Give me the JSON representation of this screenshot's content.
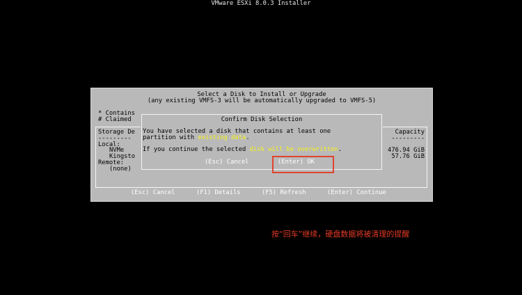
{
  "installer_title": "VMware ESXi 8.0.3 Installer",
  "select_disk": {
    "line1": "Select a Disk to Install or Upgrade",
    "line2": "(any existing VMFS-3 will be automatically upgraded to VMFS-5)",
    "legend_contains": "* Contains",
    "legend_claimed": "# Claimed",
    "col_storage": "Storage De",
    "col_capacity": "Capacity",
    "dash_left": "---------",
    "dash_right": "---------",
    "group_local": "Local:",
    "disk1_name": "NVMe",
    "disk2_name": "Kingsto",
    "group_remote": "Remote:",
    "none": "(none)",
    "disk1_capacity": "476.94 GiB",
    "disk2_capacity": "57.76 GiB"
  },
  "footer": {
    "cancel": "(Esc) Cancel",
    "details": "(F1) Details",
    "refresh": "(F5) Refresh",
    "continue": "(Enter) Continue"
  },
  "dialog": {
    "title": "Confirm Disk Selection",
    "line1": "You have selected a disk that contains at least one",
    "line2_prefix": "partition with ",
    "line2_highlight": "existing data",
    "line2_suffix": ".",
    "line3_prefix": "If you continue the selected ",
    "line3_highlight": "disk will be overwritten",
    "line3_suffix": ".",
    "cancel_button": "(Esc) Cancel",
    "ok_button": "(Enter) OK"
  },
  "annotation": "按“回车”继续，硬盘数据将被清理的提醒",
  "colors": {
    "screen_bg": "#000000",
    "panel_bg": "#b9b9b9",
    "highlight_yellow": "#f6f21a",
    "annotation_red": "#e23a24"
  }
}
